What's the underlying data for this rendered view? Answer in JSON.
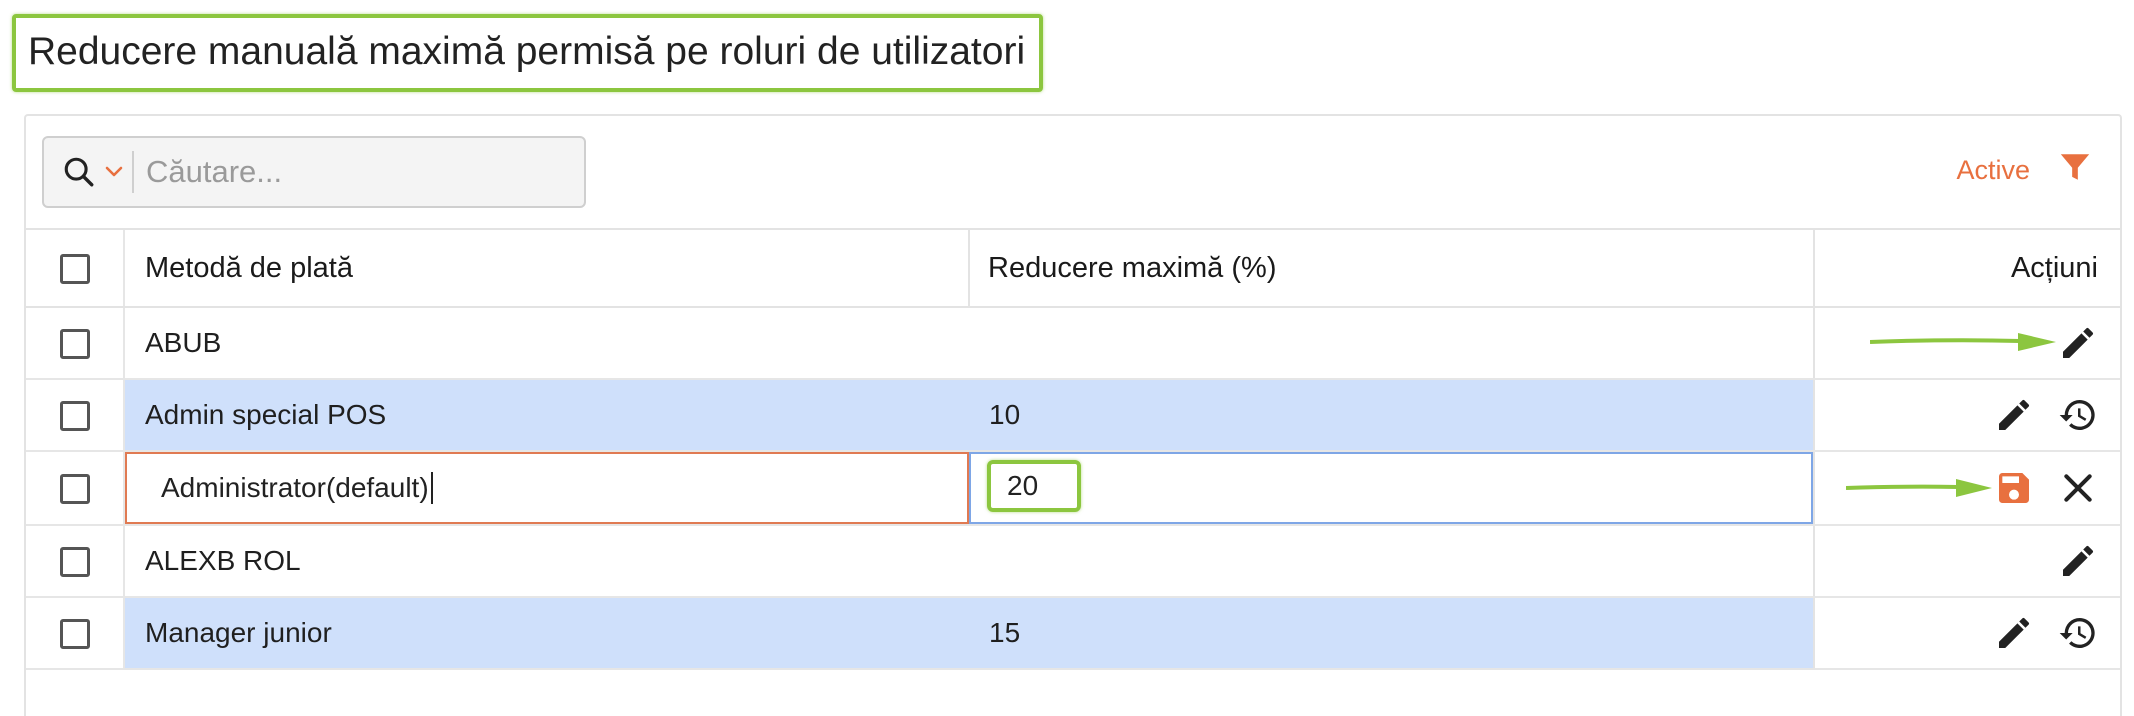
{
  "page": {
    "title": "Reducere manuală maximă permisă pe roluri de utilizatori"
  },
  "toolbar": {
    "search_placeholder": "Căutare...",
    "filter_label": "Active"
  },
  "table": {
    "headers": {
      "name": "Metodă de plată",
      "value": "Reducere maximă (%)",
      "actions": "Acțiuni"
    },
    "rows": [
      {
        "name": "ABUB",
        "value": ""
      },
      {
        "name": "Admin special POS",
        "value": "10"
      },
      {
        "name": "Administrator(default)",
        "value": "20"
      },
      {
        "name": "ALEXB ROL",
        "value": ""
      },
      {
        "name": "Manager junior",
        "value": "15"
      }
    ]
  },
  "colors": {
    "accent": "#e8703f",
    "highlight_row": "#cfe0fb",
    "annotation_green": "#8cc63f",
    "edit_border": "#7ea6e6"
  },
  "icons": [
    "search-icon",
    "chevron-down-icon",
    "filter-icon",
    "edit-icon",
    "history-icon",
    "save-icon",
    "close-icon"
  ]
}
